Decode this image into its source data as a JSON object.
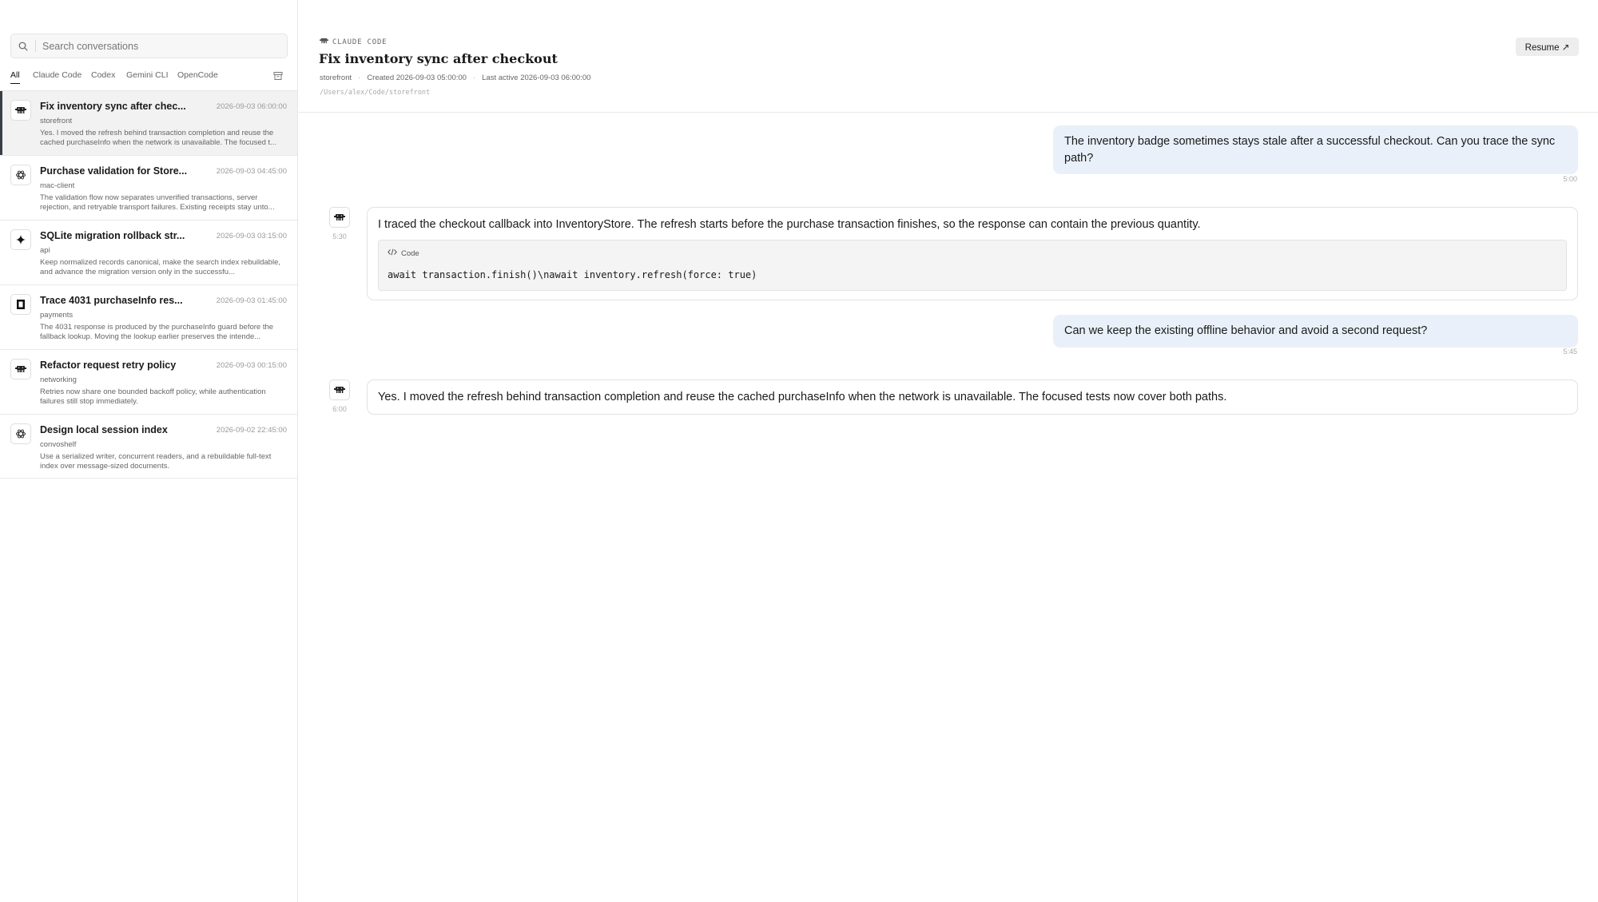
{
  "sidebar": {
    "search_placeholder": "Search conversations",
    "filters": [
      "All",
      "Claude Code",
      "Codex",
      "Gemini CLI",
      "OpenCode"
    ],
    "active_filter": "All",
    "conversations": [
      {
        "title": "Fix inventory sync after chec...",
        "date": "2026-09-03 06:00:00",
        "project": "storefront",
        "snippet": "Yes. I moved the refresh behind transaction completion and reuse the cached purchaseInfo when the network is unavailable. The focused t...",
        "icon": "claude-code-icon",
        "selected": true
      },
      {
        "title": "Purchase validation for Store...",
        "date": "2026-09-03 04:45:00",
        "project": "mac-client",
        "snippet": "The validation flow now separates unverified transactions, server rejection, and retryable transport failures. Existing receipts stay unto...",
        "icon": "codex-icon",
        "selected": false
      },
      {
        "title": "SQLite migration rollback str...",
        "date": "2026-09-03 03:15:00",
        "project": "api",
        "snippet": "Keep normalized records canonical, make the search index rebuildable, and advance the migration version only in the successfu...",
        "icon": "gemini-icon",
        "selected": false
      },
      {
        "title": "Trace 4031 purchaseInfo res...",
        "date": "2026-09-03 01:45:00",
        "project": "payments",
        "snippet": "The 4031 response is produced by the purchaseInfo guard before the fallback lookup. Moving the lookup earlier preserves the intende...",
        "icon": "opencode-icon",
        "selected": false
      },
      {
        "title": "Refactor request retry policy",
        "date": "2026-09-03 00:15:00",
        "project": "networking",
        "snippet": "Retries now share one bounded backoff policy, while authentication failures still stop immediately.",
        "icon": "claude-code-icon",
        "selected": false
      },
      {
        "title": "Design local session index",
        "date": "2026-09-02 22:45:00",
        "project": "convoshelf",
        "snippet": "Use a serialized writer, concurrent readers, and a rebuildable full-text index over message-sized documents.",
        "icon": "codex-icon",
        "selected": false
      }
    ]
  },
  "header": {
    "source": "CLAUDE CODE",
    "title": "Fix inventory sync after checkout",
    "project": "storefront",
    "created": "Created 2026-09-03 05:00:00",
    "last_active": "Last active 2026-09-03 06:00:00",
    "path": "/Users/alex/Code/storefront",
    "resume_label": "Resume ↗",
    "separator": "·"
  },
  "messages": [
    {
      "role": "user",
      "text": "The inventory badge sometimes stays stale after a successful checkout. Can you trace the sync path?",
      "time": "5:00"
    },
    {
      "role": "assistant",
      "text": "I traced the checkout callback into InventoryStore. The refresh starts before the purchase transaction finishes, so the response can contain the previous quantity.",
      "time": "5:30",
      "code_label": "Code",
      "code": "await transaction.finish()\\nawait inventory.refresh(force: true)"
    },
    {
      "role": "user",
      "text": "Can we keep the existing offline behavior and avoid a second request?",
      "time": "5:45"
    },
    {
      "role": "assistant",
      "text": "Yes. I moved the refresh behind transaction completion and reuse the cached purchaseInfo when the network is unavailable. The focused tests now cover both paths.",
      "time": "6:00"
    }
  ],
  "colors": {
    "user_bubble": "#e9f0f9",
    "selected_row": "#f2f2f2",
    "selected_accent": "#3a3f47"
  }
}
